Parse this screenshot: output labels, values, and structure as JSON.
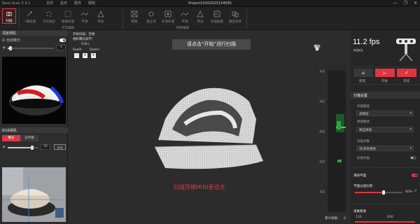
{
  "titlebar": {
    "app": "Revo Scan 5.3.1",
    "menu": [
      "文件",
      "显示",
      "配件",
      "帮助"
    ],
    "project": "Project1016202313458S",
    "controls": [
      "—",
      "❐",
      "✕"
    ]
  },
  "ribbon": {
    "buttons": [
      {
        "label": "扫描",
        "icon": "scan-icon"
      },
      {
        "label": "一键处理",
        "icon": "one-click-icon"
      },
      {
        "label": "点云融合",
        "icon": "fusion-icon"
      },
      {
        "label": "离散处理",
        "icon": "isolation-icon"
      },
      {
        "label": "平滑",
        "icon": "smooth-icon"
      },
      {
        "label": "简化",
        "icon": "simplify-icon"
      },
      {
        "label": "网格",
        "icon": "mesh-icon"
      },
      {
        "label": "孤立项",
        "icon": "isolated-icon"
      },
      {
        "label": "补洞补漏",
        "icon": "fill-hole-icon"
      },
      {
        "label": "平滑",
        "icon": "mesh-smooth-icon"
      },
      {
        "label": "简化",
        "icon": "mesh-simplify-icon"
      },
      {
        "label": "纹理贴图",
        "icon": "texture-icon"
      },
      {
        "label": "模型合并",
        "icon": "merge-icon"
      }
    ],
    "groups": [
      "点云编辑",
      "网格编辑"
    ]
  },
  "left": {
    "depth_camera": {
      "title": "深度相机",
      "auto_exposure": "自动曝光",
      "exposure_value": "1",
      "preview_label": "深度预览"
    },
    "rgb_camera": {
      "title": "RGB相机",
      "tabs": [
        "曝光",
        "白平衡"
      ],
      "value": "50",
      "auto_label": "自动"
    }
  },
  "viewport": {
    "status": {
      "mode": "开始扫描：空格",
      "adjust": "相机曝光调节：",
      "rgb": "RGB+",
      "depth_minus": "Depth-",
      "depth_plus": "Depth+",
      "keys": [
        "-",
        "+",
        "+"
      ]
    },
    "hint": "请点击“开始”进行扫描",
    "footer_note": "扫描牙模MINI更适合",
    "hist_labels": [
      "太近",
      "太近",
      "太远",
      "太远",
      "太远"
    ],
    "frames_label": "累计帧数：",
    "frames_value": "0"
  },
  "right": {
    "fps": "11.2 fps",
    "device": "POP3",
    "actions": [
      {
        "label": "新建",
        "icon": "plus-icon"
      },
      {
        "label": "开始",
        "icon": "play-icon"
      },
      {
        "label": "完成",
        "icon": "check-icon"
      }
    ],
    "section_title": "扫描设置",
    "scan_precision_label": "扫描精度",
    "scan_precision_value": "高精度",
    "scan_mode_label": "拼接模式",
    "scan_mode_value": "特征拼接",
    "scan_object_label": "扫描对象",
    "scan_object_value": "深/黑色物体",
    "color_scan_label": "彩色扫描",
    "remove_plane_label": "清除平面",
    "plane_filter_label": "平面过滤比例",
    "plane_filter_value": "60%",
    "plane_filter_fraction": 0.6,
    "distance_label": "采集距离",
    "distance_min": "130",
    "distance_max": "600",
    "accent": "#e0363f"
  }
}
